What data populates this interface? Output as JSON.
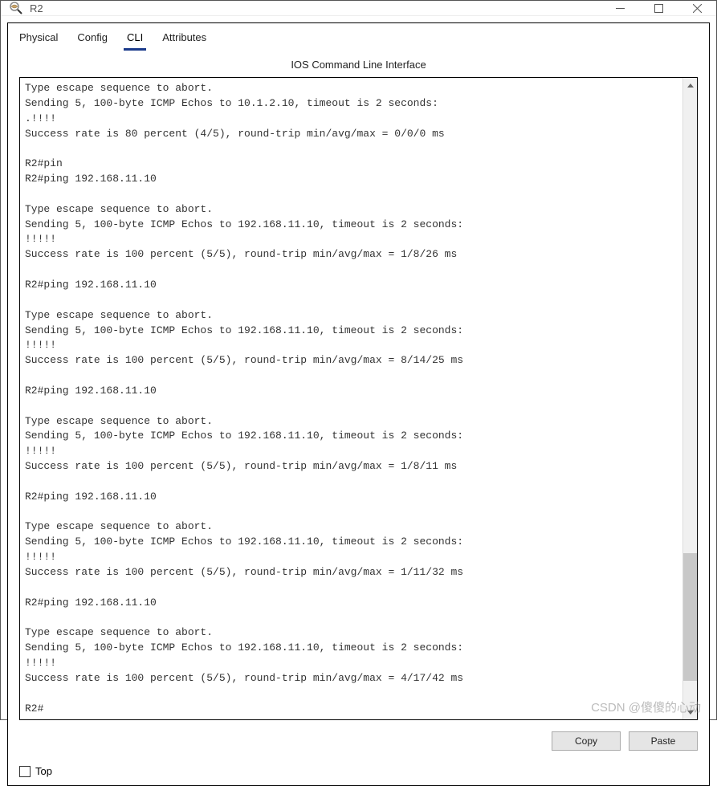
{
  "window": {
    "title": "R2"
  },
  "tabs": {
    "physical": "Physical",
    "config": "Config",
    "cli": "CLI",
    "attributes": "Attributes"
  },
  "cli_header": "IOS Command Line Interface",
  "terminal_output": "Type escape sequence to abort.\nSending 5, 100-byte ICMP Echos to 10.1.2.10, timeout is 2 seconds:\n.!!!!\nSuccess rate is 80 percent (4/5), round-trip min/avg/max = 0/0/0 ms\n\nR2#pin\nR2#ping 192.168.11.10\n\nType escape sequence to abort.\nSending 5, 100-byte ICMP Echos to 192.168.11.10, timeout is 2 seconds:\n!!!!!\nSuccess rate is 100 percent (5/5), round-trip min/avg/max = 1/8/26 ms\n\nR2#ping 192.168.11.10\n\nType escape sequence to abort.\nSending 5, 100-byte ICMP Echos to 192.168.11.10, timeout is 2 seconds:\n!!!!!\nSuccess rate is 100 percent (5/5), round-trip min/avg/max = 8/14/25 ms\n\nR2#ping 192.168.11.10\n\nType escape sequence to abort.\nSending 5, 100-byte ICMP Echos to 192.168.11.10, timeout is 2 seconds:\n!!!!!\nSuccess rate is 100 percent (5/5), round-trip min/avg/max = 1/8/11 ms\n\nR2#ping 192.168.11.10\n\nType escape sequence to abort.\nSending 5, 100-byte ICMP Echos to 192.168.11.10, timeout is 2 seconds:\n!!!!!\nSuccess rate is 100 percent (5/5), round-trip min/avg/max = 1/11/32 ms\n\nR2#ping 192.168.11.10\n\nType escape sequence to abort.\nSending 5, 100-byte ICMP Echos to 192.168.11.10, timeout is 2 seconds:\n!!!!!\nSuccess rate is 100 percent (5/5), round-trip min/avg/max = 4/17/42 ms\n\nR2#",
  "buttons": {
    "copy": "Copy",
    "paste": "Paste"
  },
  "footer": {
    "top_label": "Top"
  },
  "watermark": "CSDN @傻傻的心动",
  "scrollbar": {
    "thumb_top_pct": 74,
    "thumb_height_pct": 20
  }
}
